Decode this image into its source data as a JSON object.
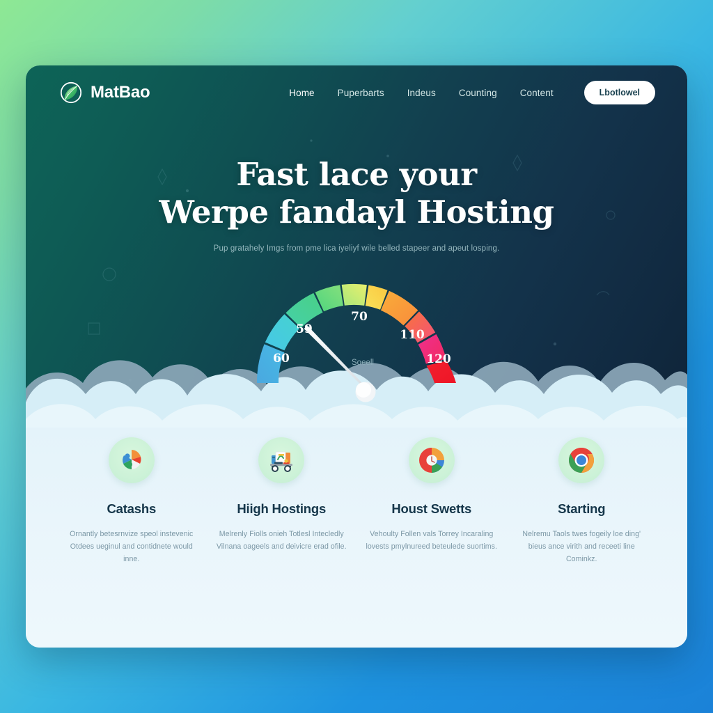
{
  "theme": {
    "page_bg_start": "#8ee894",
    "page_bg_end": "#1b82d8",
    "hero_bg_start": "#0d6457",
    "hero_bg_end": "#0f2438",
    "cta_bg": "#ffffff",
    "cta_text": "#173f4d",
    "features_bg": "#e9f5fb",
    "icon_ring_bg": "#cdf2d8",
    "heading_color": "#ffffff",
    "feature_title_color": "#15364a"
  },
  "navbar": {
    "brand": {
      "name": "MatBao",
      "logo_icon": "leaf-globe-icon"
    },
    "links": [
      {
        "label": "Home",
        "active": true
      },
      {
        "label": "Puperbarts",
        "active": false
      },
      {
        "label": "Indeus",
        "active": false
      },
      {
        "label": "Counting",
        "active": false
      },
      {
        "label": "Content",
        "active": false
      }
    ],
    "cta": {
      "label": "Lbotlowel"
    }
  },
  "hero": {
    "title_line1": "Fast lace your",
    "title_line2": "Werpe fandayl Hosting",
    "subtitle": "Pup gratahely Imgs from pme lica iyeliyf wile belled stapeer and apeut losping."
  },
  "chart_data": {
    "type": "gauge",
    "title": "",
    "center_label": "Soeell",
    "value": 59,
    "min": 50,
    "max": 130,
    "ticks": [
      {
        "label": "60",
        "angle_deg": -157
      },
      {
        "label": "59",
        "angle_deg": -128
      },
      {
        "label": "70",
        "angle_deg": -90
      },
      {
        "label": "110",
        "angle_deg": -48
      },
      {
        "label": "120",
        "angle_deg": -19
      }
    ],
    "needle_angle_deg": -122,
    "bands": [
      {
        "name": "blue",
        "color": "#4aa8e0",
        "from_deg": 180,
        "to_deg": 158
      },
      {
        "name": "cyan",
        "color": "#46c8e6",
        "from_deg": 158,
        "to_deg": 136
      },
      {
        "name": "teal-green",
        "color": "#45cfa8",
        "from_deg": 136,
        "to_deg": 116
      },
      {
        "name": "green",
        "color": "#4ed47f",
        "from_deg": 116,
        "to_deg": 99
      },
      {
        "name": "light-green",
        "color": "#a8e87b",
        "from_deg": 99,
        "to_deg": 84
      },
      {
        "name": "yellow",
        "color": "#f5d94a",
        "from_deg": 84,
        "to_deg": 72
      },
      {
        "name": "orange",
        "color": "#f9ad39",
        "from_deg": 72,
        "to_deg": 52
      },
      {
        "name": "deep-orange",
        "color": "#f7743c",
        "from_deg": 52,
        "to_deg": 38
      },
      {
        "name": "magenta",
        "color": "#ef2f8f",
        "from_deg": 38,
        "to_deg": 22
      },
      {
        "name": "red",
        "color": "#f01f28",
        "from_deg": 22,
        "to_deg": 0
      }
    ],
    "grid": false,
    "legend": "none"
  },
  "features": [
    {
      "icon": "pie-chart-icon",
      "title": "Catashs",
      "desc": "Ornantly betesrnvize speol instevenic Otdees ueginul and contidnete would inne."
    },
    {
      "icon": "delivery-cart-icon",
      "title": "Hiigh Hostings",
      "desc": "Melrenly Fiolls onieh Totlesl Intecledly Vilnana oageels and deivicre erad ofile."
    },
    {
      "icon": "google-g-icon",
      "title": "Houst Swetts",
      "desc": "Vehoulty Follen vals Torrey Incaraling lovests pmylnureed beteulede suortims."
    },
    {
      "icon": "chrome-icon",
      "title": "Starting",
      "desc": "Nelremu Taols twes fogeily loe ding' bieus ance virith and receeti line Cominkz."
    }
  ]
}
